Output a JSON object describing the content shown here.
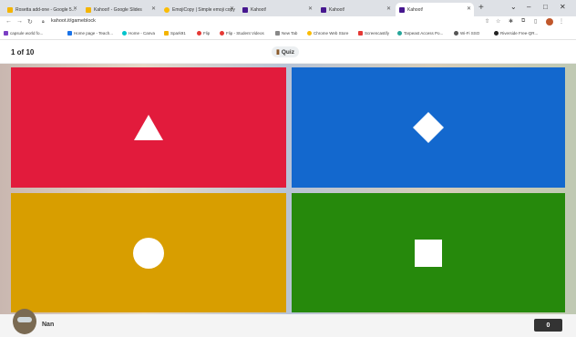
{
  "browser": {
    "tabs": [
      {
        "title": "Rosetta add-one - Google 5...",
        "color": "#f4b400"
      },
      {
        "title": "Kahoot! - Google Slides",
        "color": "#f4b400"
      },
      {
        "title": "EmojiCopy | Simple emoji copy",
        "color": "#fbbc04"
      },
      {
        "title": "Kahoot!",
        "color": "#46178f"
      },
      {
        "title": "Kahoot!",
        "color": "#46178f"
      },
      {
        "title": "Kahoot!",
        "color": "#46178f"
      }
    ],
    "url": "kahoot.it/gameblock",
    "bookmarks": [
      {
        "label": "capsule world fo...",
        "color": "#7b3fc4"
      },
      {
        "label": "Home page - Teach...",
        "color": "#1a73e8"
      },
      {
        "label": "Home - Canva",
        "color": "#00c4cc"
      },
      {
        "label": "Spark91",
        "color": "#f4b400"
      },
      {
        "label": "Flip",
        "color": "#e53935"
      },
      {
        "label": "Flip - Student Videos",
        "color": "#e53935"
      },
      {
        "label": "New Tab",
        "color": "#888888"
      },
      {
        "label": "Chrome Web Store",
        "color": "#fbbc04"
      },
      {
        "label": "Screencastify",
        "color": "#e53935"
      },
      {
        "label": "Tarpeast Access Po...",
        "color": "#26a69a"
      },
      {
        "label": "Wi-Fi SSO",
        "color": "#555555"
      },
      {
        "label": "Riverside Free-QR...",
        "color": "#222222"
      }
    ]
  },
  "game": {
    "question_counter": "1 of 10",
    "quiz_label": "Quiz",
    "answers": [
      {
        "shape": "triangle-icon",
        "color": "#e21b3c"
      },
      {
        "shape": "diamond-icon",
        "color": "#1368ce"
      },
      {
        "shape": "circle-icon",
        "color": "#d89e00"
      },
      {
        "shape": "square-icon",
        "color": "#26890c"
      }
    ],
    "player_name": "Nan",
    "score": "0"
  }
}
